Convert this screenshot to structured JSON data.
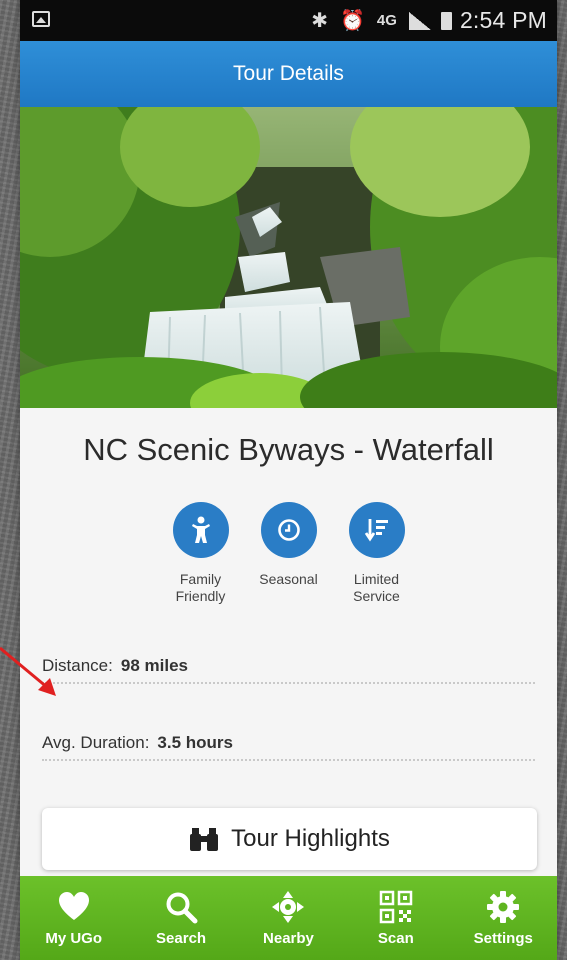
{
  "status_bar": {
    "time": "2:54 PM",
    "icons": [
      "gallery-icon",
      "bluetooth-icon",
      "alarm-icon",
      "4g-lte-icon",
      "signal-icon",
      "battery-icon"
    ]
  },
  "header": {
    "title": "Tour Details"
  },
  "tour": {
    "name": "NC Scenic Byways - Waterfall",
    "features": [
      {
        "icon": "family-icon",
        "label": "Family Friendly"
      },
      {
        "icon": "clock-icon",
        "label": "Seasonal"
      },
      {
        "icon": "limited-service-icon",
        "label": "Limited Service"
      }
    ],
    "distance": {
      "label": "Distance:",
      "value": "98 miles"
    },
    "duration": {
      "label": "Avg. Duration:",
      "value": "3.5 hours"
    },
    "highlights_label": "Tour Highlights"
  },
  "tab_bar": {
    "items": [
      {
        "icon": "heart-icon",
        "label": "My UGo"
      },
      {
        "icon": "search-icon",
        "label": "Search"
      },
      {
        "icon": "crosshair-icon",
        "label": "Nearby"
      },
      {
        "icon": "qr-code-icon",
        "label": "Scan"
      },
      {
        "icon": "gear-icon",
        "label": "Settings"
      }
    ]
  },
  "colors": {
    "app_bar": "#2a82cf",
    "feature_icon": "#2a7dc6",
    "tab_bar": "#5fb41f",
    "annotation_arrow": "#e02020"
  }
}
